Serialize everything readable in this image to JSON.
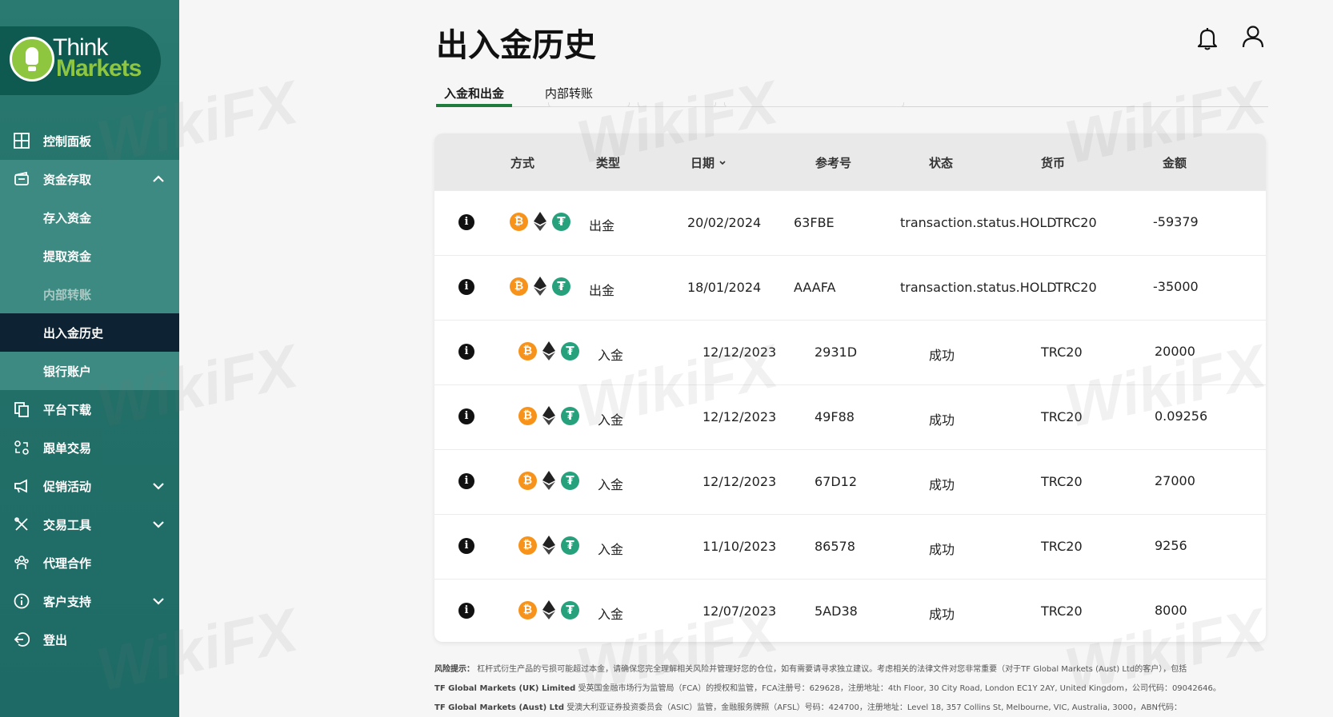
{
  "brand": {
    "think": "Think",
    "markets": "Markets",
    "green": "#8ec63f",
    "sidebar_color": "#237068"
  },
  "header": {
    "title": "出入金历史"
  },
  "sidebar": {
    "items": [
      {
        "label": "控制面板",
        "icon": "dashboard-icon"
      },
      {
        "label": "资金存取",
        "icon": "wallet-icon",
        "expanded": true,
        "children": [
          {
            "label": "存入资金"
          },
          {
            "label": "提取资金"
          },
          {
            "label": "内部转账",
            "disabled": true
          },
          {
            "label": "出入金历史",
            "active": true
          },
          {
            "label": "银行账户"
          }
        ]
      },
      {
        "label": "平台下载",
        "icon": "copy-icon"
      },
      {
        "label": "跟单交易",
        "icon": "copy-trade-icon"
      },
      {
        "label": "促销活动",
        "icon": "megaphone-icon",
        "expandable": true
      },
      {
        "label": "交易工具",
        "icon": "tools-icon",
        "expandable": true
      },
      {
        "label": "代理合作",
        "icon": "partners-icon"
      },
      {
        "label": "客户支持",
        "icon": "info-icon",
        "expandable": true
      },
      {
        "label": "登出",
        "icon": "logout-icon"
      }
    ]
  },
  "tabs": [
    {
      "label": "入金和出金",
      "active": true
    },
    {
      "label": "内部转账",
      "active": false
    }
  ],
  "table": {
    "headers": {
      "method": "方式",
      "type": "类型",
      "date": "日期",
      "ref": "参考号",
      "status": "状态",
      "currency": "货币",
      "amount": "金额"
    },
    "rows": [
      {
        "type": "出金",
        "date": "20/02/2024",
        "ref": "63FBE",
        "status": "transaction.status.HOLD",
        "currency": "TRC20",
        "amount": "-59379"
      },
      {
        "type": "出金",
        "date": "18/01/2024",
        "ref": "AAAFA",
        "status": "transaction.status.HOLD",
        "currency": "TRC20",
        "amount": "-35000"
      },
      {
        "type": "入金",
        "date": "12/12/2023",
        "ref": "2931D",
        "status": "成功",
        "currency": "TRC20",
        "amount": "20000"
      },
      {
        "type": "入金",
        "date": "12/12/2023",
        "ref": "49F88",
        "status": "成功",
        "currency": "TRC20",
        "amount": "0.09256"
      },
      {
        "type": "入金",
        "date": "12/12/2023",
        "ref": "67D12",
        "status": "成功",
        "currency": "TRC20",
        "amount": "27000"
      },
      {
        "type": "入金",
        "date": "11/10/2023",
        "ref": "86578",
        "status": "成功",
        "currency": "TRC20",
        "amount": "9256"
      },
      {
        "type": "入金",
        "date": "12/07/2023",
        "ref": "5AD38",
        "status": "成功",
        "currency": "TRC20",
        "amount": "8000"
      }
    ],
    "coin_icons": [
      "bitcoin-icon",
      "ethereum-icon",
      "tether-icon"
    ],
    "info_glyph": "i",
    "btc_glyph": "₿",
    "usdt_glyph": "₮"
  },
  "disclaimer": {
    "line1_label": "风险提示：",
    "line1": "杠杆式衍生产品的亏损可能超过本金，请确保您完全理解相关风险并管理好您的仓位，如有需要请寻求独立建议。考虑相关的法律文件对您非常重要（对于TF Global Markets (Aust) Ltd的客户），包括",
    "line2_label": "TF Global Markets (UK) Limited",
    "line2": "受英国金融市场行为监管局（FCA）的授权和监管，FCA注册号：629628，注册地址：4th Floor, 30 City Road, London EC1Y 2AY, United Kingdom，公司代码：09042646。",
    "line3_label": "TF Global Markets (Aust) Ltd",
    "line3": "受澳大利亚证券投资委员会（ASIC）监管，金融服务牌照（AFSL）号码：424700，注册地址：Level 18, 357 Collins St, Melbourne, VIC, Australia, 3000，ABN代码：69158361561。"
  },
  "watermark": "WikiFX"
}
